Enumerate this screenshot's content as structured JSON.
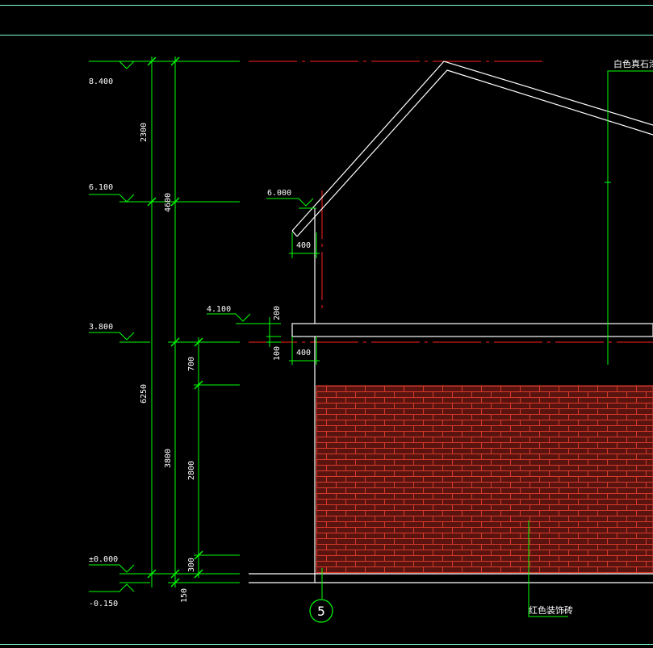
{
  "colors": {
    "background": "#000000",
    "dimension": "#00ff00",
    "object": "#ffffff",
    "centerline": "#ff2020",
    "border": "#7fffd4",
    "brick_fill": "#5a1410",
    "brick_joint": "#d83a2a"
  },
  "drawing": {
    "elevation_marks": {
      "ridge": "8.400",
      "eave": "6.100",
      "roof_edge": "6.000",
      "canopy_top": "4.100",
      "floor_two": "3.800",
      "ground": "±0.000",
      "outdoor": "-0.150"
    },
    "dimensions": {
      "d2300": "2300",
      "d4600": "4600",
      "d6250": "6250",
      "d3800": "3800",
      "d700": "700",
      "d2800": "2800",
      "d300": "300",
      "d150": "150",
      "d200": "200",
      "d100": "100",
      "d400_top": "400",
      "d400_bottom": "400"
    },
    "grid_axis": "5",
    "annotations": {
      "stone_paint": "白色真石漆",
      "red_brick": "红色装饰砖"
    }
  }
}
